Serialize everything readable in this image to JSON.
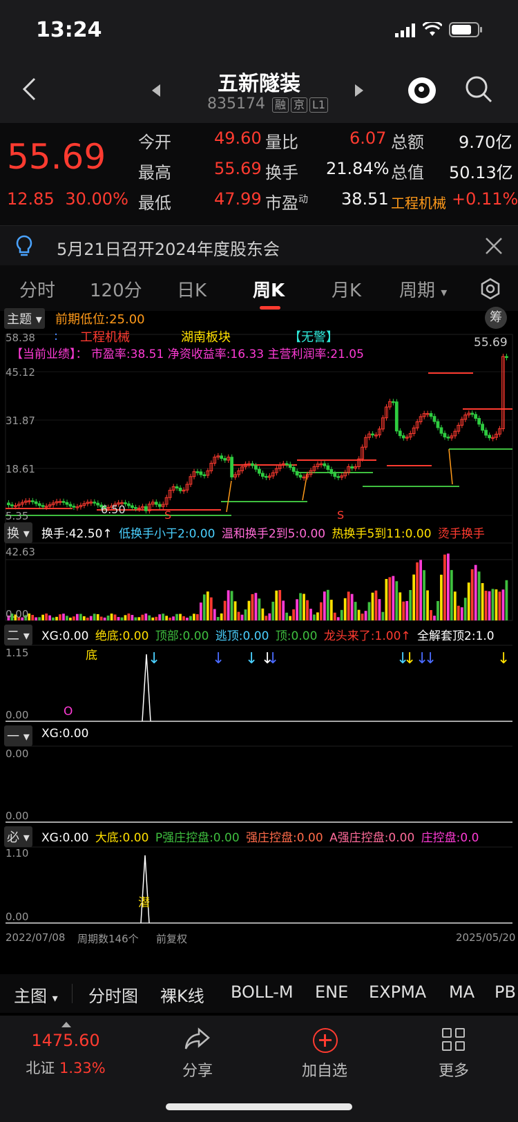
{
  "status": {
    "time": "13:24"
  },
  "nav": {
    "title": "五新隧装",
    "code": "835174",
    "tags": [
      "融",
      "京",
      "L1"
    ]
  },
  "quote": {
    "price": "55.69",
    "change": "12.85",
    "change_pct": "30.00%",
    "rows": [
      [
        {
          "l": "今开",
          "v": "49.60"
        },
        {
          "l": "量比",
          "v": "6.07"
        },
        {
          "l": "总额",
          "v": "9.70亿"
        }
      ],
      [
        {
          "l": "最高",
          "v": "55.69"
        },
        {
          "l": "换手",
          "v": "21.84%"
        },
        {
          "l": "总值",
          "v": "50.13亿"
        }
      ],
      [
        {
          "l": "最低",
          "v": "47.99"
        },
        {
          "l": "市盈",
          "v": "38.51",
          "sup": "动"
        },
        {
          "l": "工程机械",
          "v": "+0.11%"
        }
      ]
    ]
  },
  "notice": {
    "text": "5月21日召开2024年度股东会"
  },
  "tabs": [
    "分时",
    "120分",
    "日K",
    "周K",
    "月K",
    "周期"
  ],
  "active_tab": "周K",
  "main_chart": {
    "theme_btn": "主题",
    "prev_low": "前期低位:25.00",
    "chip_btn": "筹",
    "y_ticks": [
      "58.38",
      "45.12",
      "31.87",
      "18.61",
      "5.35"
    ],
    "info1": [
      ":",
      "工程机械",
      "湖南板块",
      "【无警】"
    ],
    "info2": "【当前业绩】： 市盈率:38.51 净资收益率:16.33 主营利润率:21.05",
    "last_price": "55.69",
    "low_mark": "6.50",
    "s_marks": [
      "S",
      "S"
    ]
  },
  "turnover": {
    "btn": "换",
    "items": [
      "换手:42.50↑",
      "低换手小于2:0.00",
      "温和换手2到5:0.00",
      "热换手5到11:0.00",
      "烫手换手"
    ],
    "y_top": "42.63",
    "y_bottom": "0.00"
  },
  "ind2": {
    "btn": "二",
    "items": [
      "XG:0.00",
      "绝底:0.00",
      "顶部:0.00",
      "逃顶:0.00",
      "顶:0.00",
      "龙头来了:1.00↑",
      "全解套顶2:1.0"
    ],
    "y_top": "1.15",
    "y_bottom": "0.00",
    "bottom_label": "底",
    "o_label": "O"
  },
  "ind1": {
    "btn": "一",
    "items": [
      "XG:0.00"
    ],
    "y_top": "0.00",
    "y_bottom": "0.00"
  },
  "ind3": {
    "btn": "必",
    "items": [
      "XG:0.00",
      "大底:0.00",
      "P强庄控盘:0.00",
      "强庄控盘:0.00",
      "A强庄控盘:0.00",
      "庄控盘:0.0"
    ],
    "y_top": "1.10",
    "y_bottom": "0.00",
    "mark": "潜"
  },
  "footer_axis": {
    "start": "2022/07/08",
    "count": "周期数146个",
    "adj": "前复权",
    "end": "2025/05/20"
  },
  "toolbar": [
    "主图",
    "分时图",
    "裸K线",
    "BOLL-M",
    "ENE",
    "EXPMA",
    "MA",
    "PB"
  ],
  "bottom": {
    "index_value": "1475.60",
    "index_name": "北证",
    "index_pct": "1.33%",
    "share": "分享",
    "add": "加自选",
    "more": "更多"
  },
  "colors": {
    "up": "#ff3b30",
    "down": "#2ecc40",
    "accent": "#ff9a1a"
  }
}
